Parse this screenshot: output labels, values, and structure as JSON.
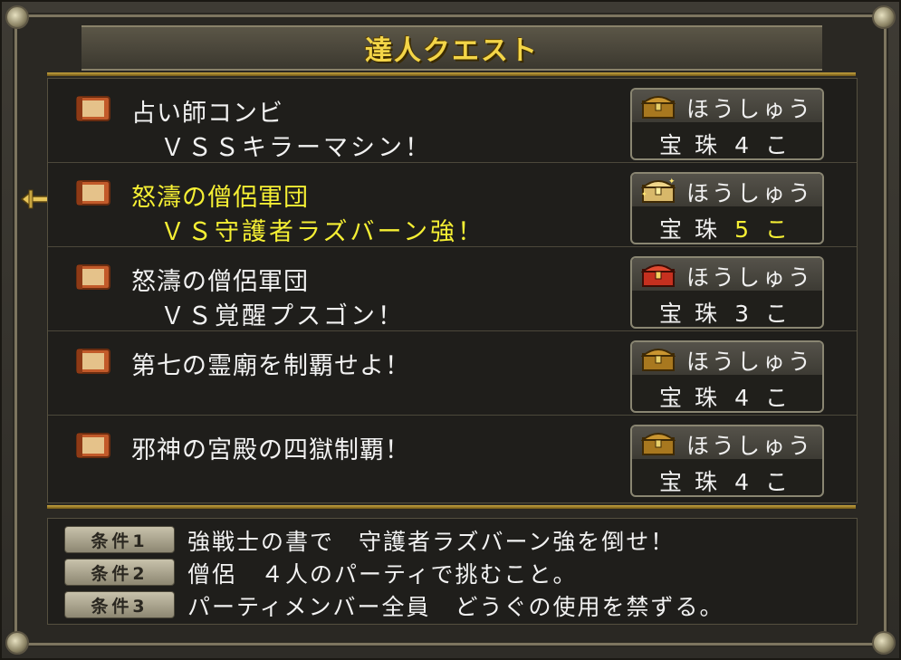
{
  "title": "達人クエスト",
  "quests": [
    {
      "line1": "占い師コンビ",
      "line2": "ＶＳＳキラーマシン！",
      "reward_label": "ほうしゅう",
      "reward_item": "宝珠",
      "reward_qty": "4こ",
      "chest_type": "gold-chest-icon",
      "selected": false
    },
    {
      "line1": "怒濤の僧侶軍団",
      "line2": "ＶＳ守護者ラズバーン強！",
      "reward_label": "ほうしゅう",
      "reward_item": "宝珠",
      "reward_qty": "5こ",
      "chest_type": "sparkle-chest-icon",
      "selected": true
    },
    {
      "line1": "怒濤の僧侶軍団",
      "line2": "ＶＳ覚醒プスゴン！",
      "reward_label": "ほうしゅう",
      "reward_item": "宝珠",
      "reward_qty": "3こ",
      "chest_type": "red-chest-icon",
      "selected": false
    },
    {
      "line1": "第七の霊廟を制覇せよ！",
      "line2": "",
      "reward_label": "ほうしゅう",
      "reward_item": "宝珠",
      "reward_qty": "4こ",
      "chest_type": "gold-chest-icon",
      "selected": false
    },
    {
      "line1": "邪神の宮殿の四獄制覇！",
      "line2": "",
      "reward_label": "ほうしゅう",
      "reward_item": "宝珠",
      "reward_qty": "4こ",
      "chest_type": "gold-chest-icon",
      "selected": false
    }
  ],
  "conditions": [
    {
      "badge": "条件1",
      "text": "強戦士の書で　守護者ラズバーン強を倒せ！"
    },
    {
      "badge": "条件2",
      "text": "僧侶　４人のパーティで挑むこと。"
    },
    {
      "badge": "条件3",
      "text": "パーティメンバー全員　どうぐの使用を禁ずる。"
    }
  ],
  "colors": {
    "title": "#f3d548",
    "selected_text": "#f5ef34",
    "normal_text": "#f2f2f2",
    "background": "#1f1e1b"
  }
}
